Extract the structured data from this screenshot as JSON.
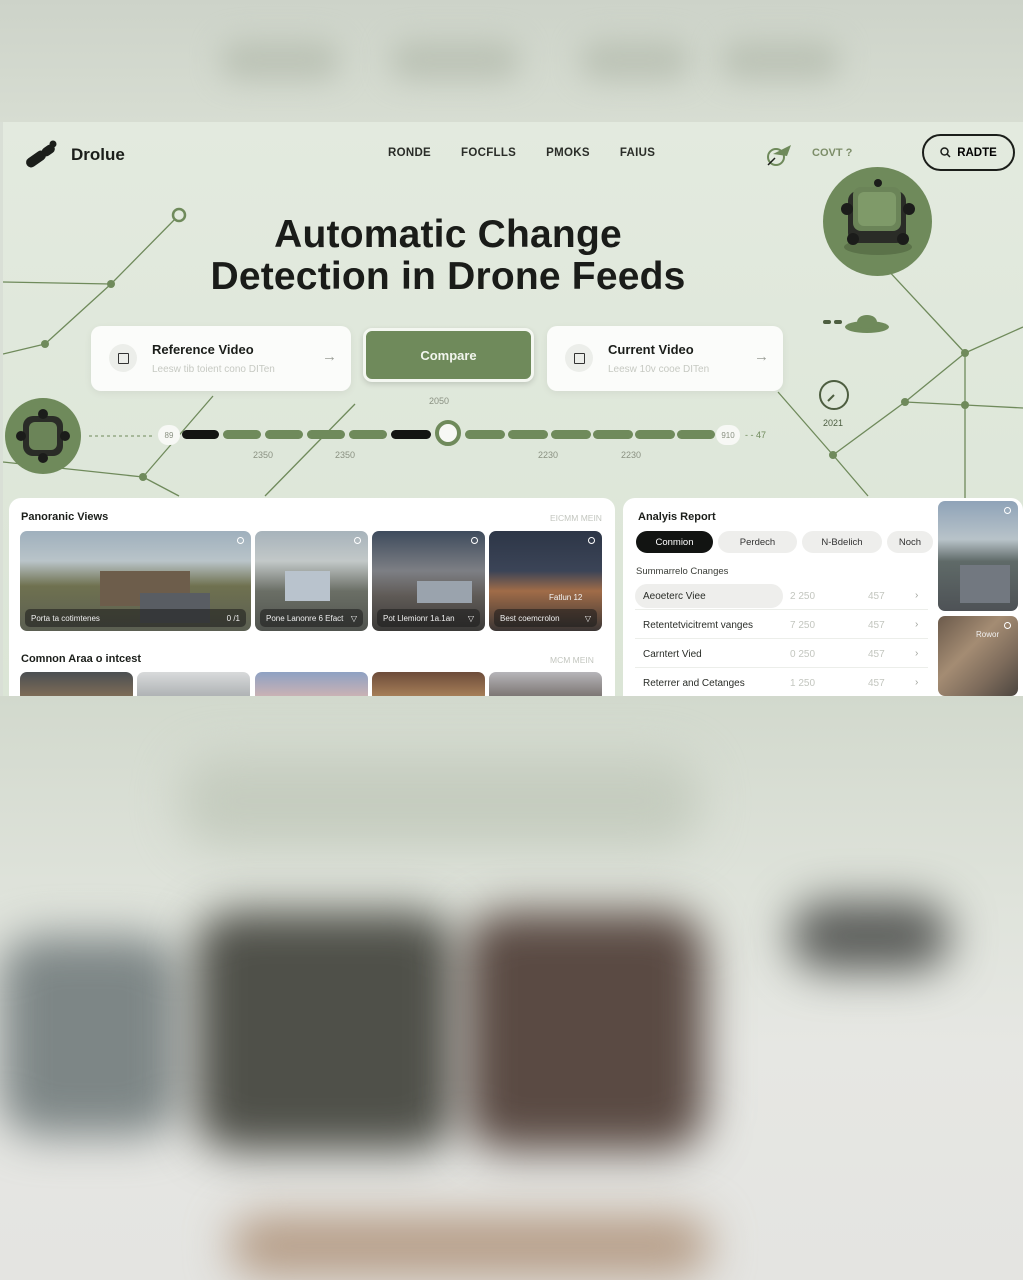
{
  "brand": {
    "name": "Drolue"
  },
  "nav": [
    "RONDE",
    "FOCFLLS",
    "PMOKS",
    "FAIUS"
  ],
  "header": {
    "cont_label": "COVT ?",
    "button_label": "RADTE"
  },
  "hero": {
    "title_line1": "Automatic Change",
    "title_line2": "Detection in Drone Feeds"
  },
  "reference_card": {
    "title": "Reference Video",
    "subtitle": "Leesw tib toient cono DITen"
  },
  "compare_button": {
    "label": "Compare"
  },
  "current_card": {
    "title": "Current Video",
    "subtitle": "Leesw 10v cooe DITen"
  },
  "timeline": {
    "center_label": "2050",
    "start_label": "89",
    "end_label": "910",
    "end_suffix": "- - 47",
    "year_label": "2021",
    "ticks": [
      "2350",
      "2350",
      "2230",
      "2230"
    ]
  },
  "panoramic": {
    "title": "Panoranic Views",
    "meta": "EICMM MEIN",
    "thumbs": [
      {
        "caption": "Porta ta cotimtenes",
        "badge": "0 /1"
      },
      {
        "caption": "Pone Lanonre 6 Efact",
        "badge": ""
      },
      {
        "caption": "Pot Llemionr 1a.1an",
        "badge": ""
      },
      {
        "caption": "Best coemcrolon",
        "badge": "",
        "overlay": "Fatlun 12"
      }
    ]
  },
  "common": {
    "title": "Comnon Araa o intcest",
    "meta": "MCM MEIN"
  },
  "analysis": {
    "title": "Analyis Report",
    "tabs": [
      "Conmion",
      "Perdech",
      "N-Bdelich",
      "Noch"
    ],
    "section_title": "Summarrelo Cnanges",
    "rows": [
      {
        "name": "Aeoeterc Viee",
        "v1": "2 250",
        "v2": "457"
      },
      {
        "name": "Retentetvicitremt vanges",
        "v1": "7 250",
        "v2": "457"
      },
      {
        "name": "Carntert Vied",
        "v1": "0 250",
        "v2": "457"
      },
      {
        "name": "Reterrer and Cetanges",
        "v1": "1 250",
        "v2": "457"
      }
    ]
  },
  "side_thumbs": [
    {
      "caption": ""
    },
    {
      "caption": "Rowor"
    }
  ],
  "colors": {
    "accent": "#6f8a5b",
    "background": "#dde6d8",
    "dark": "#131512"
  }
}
